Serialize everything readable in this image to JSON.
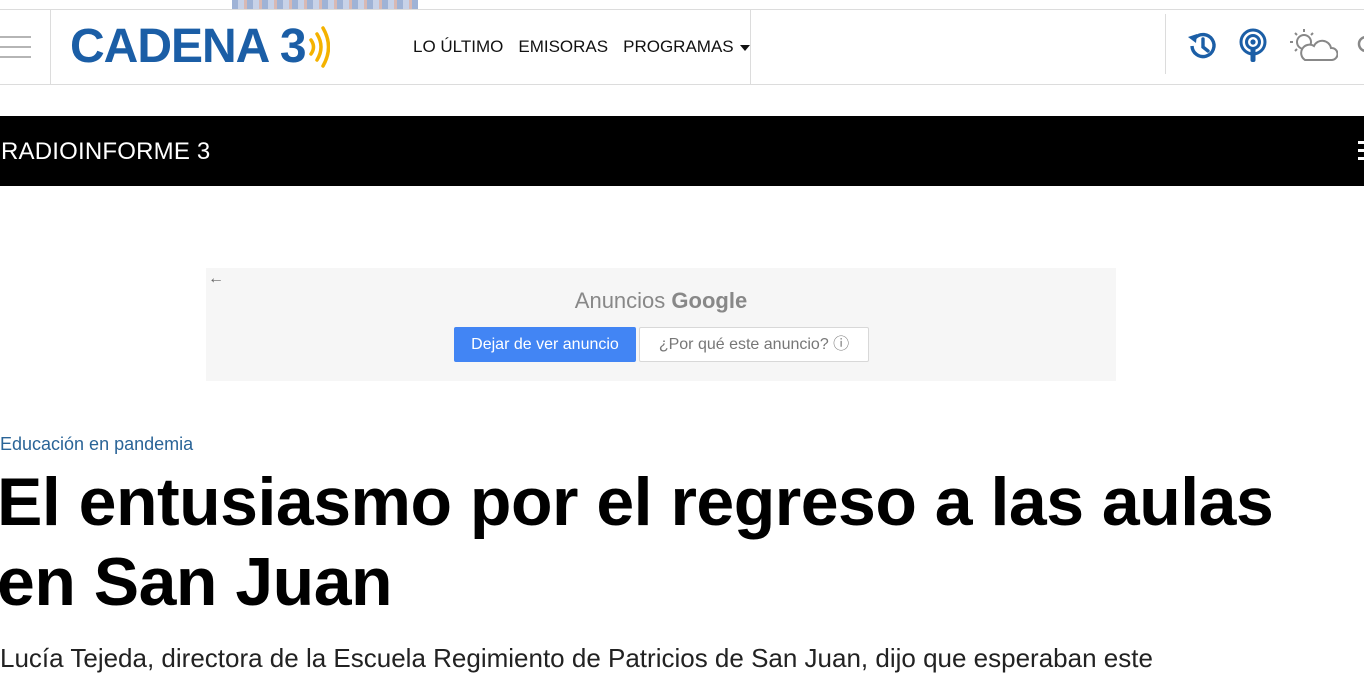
{
  "header": {
    "logo_text": "CADENA 3",
    "nav": [
      {
        "label": "LO ÚLTIMO"
      },
      {
        "label": "EMISORAS"
      },
      {
        "label": "PROGRAMAS"
      }
    ],
    "icons": [
      "history-icon",
      "podcast-icon",
      "weather-icon",
      "search-icon"
    ],
    "brand_color": "#1b5ea6",
    "accent_color": "#f4b200"
  },
  "subbar": {
    "title": "RADIOINFORME 3"
  },
  "ad": {
    "label_prefix": "Anuncios",
    "label_brand": "Google",
    "stop_button": "Dejar de ver anuncio",
    "why_button": "¿Por qué este anuncio? ⓘ"
  },
  "article": {
    "category": "Educación en pandemia",
    "headline": "El entusiasmo por el regreso a las aulas en San Juan",
    "lead": "Lucía Tejeda, directora de la Escuela Regimiento de Patricios de San Juan, dijo que esperaban este"
  }
}
